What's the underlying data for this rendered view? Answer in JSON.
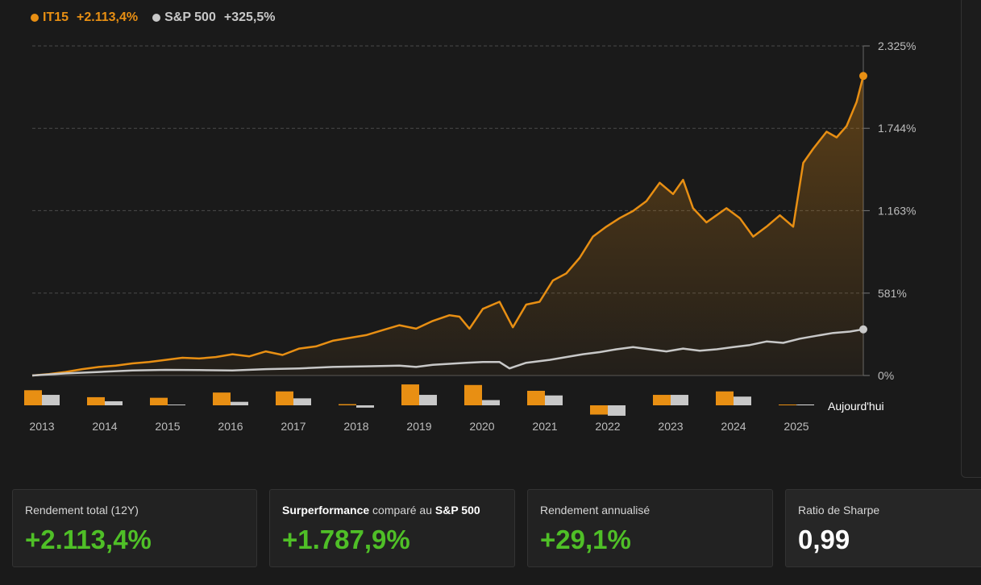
{
  "legend": {
    "series": [
      {
        "name": "IT15",
        "value": "+2.113,4%",
        "color": "#e88f13"
      },
      {
        "name": "S&P 500",
        "value": "+325,5%",
        "color": "#c8c8c8"
      }
    ]
  },
  "chart_data": {
    "type": "line",
    "x_range": [
      2013.0,
      2025.45
    ],
    "ylim": [
      0,
      2325
    ],
    "y_ticks": [
      "2.325%",
      "1.744%",
      "1.163%",
      "581%",
      "0%"
    ],
    "y_tick_values": [
      2325,
      1744,
      1163,
      581,
      0
    ],
    "grid": true,
    "series": [
      {
        "name": "IT15",
        "color": "#e88f13",
        "points": [
          [
            2013.0,
            0
          ],
          [
            2013.25,
            10
          ],
          [
            2013.5,
            25
          ],
          [
            2013.75,
            45
          ],
          [
            2014.0,
            60
          ],
          [
            2014.25,
            70
          ],
          [
            2014.5,
            85
          ],
          [
            2014.75,
            95
          ],
          [
            2015.0,
            110
          ],
          [
            2015.25,
            125
          ],
          [
            2015.5,
            120
          ],
          [
            2015.75,
            130
          ],
          [
            2016.0,
            150
          ],
          [
            2016.25,
            135
          ],
          [
            2016.5,
            170
          ],
          [
            2016.75,
            145
          ],
          [
            2017.0,
            190
          ],
          [
            2017.25,
            205
          ],
          [
            2017.5,
            245
          ],
          [
            2017.75,
            265
          ],
          [
            2018.0,
            285
          ],
          [
            2018.25,
            320
          ],
          [
            2018.5,
            355
          ],
          [
            2018.75,
            330
          ],
          [
            2019.0,
            385
          ],
          [
            2019.25,
            425
          ],
          [
            2019.4,
            415
          ],
          [
            2019.55,
            330
          ],
          [
            2019.75,
            470
          ],
          [
            2020.0,
            520
          ],
          [
            2020.2,
            340
          ],
          [
            2020.4,
            500
          ],
          [
            2020.6,
            520
          ],
          [
            2020.8,
            670
          ],
          [
            2021.0,
            720
          ],
          [
            2021.2,
            830
          ],
          [
            2021.4,
            980
          ],
          [
            2021.6,
            1050
          ],
          [
            2021.8,
            1110
          ],
          [
            2022.0,
            1160
          ],
          [
            2022.2,
            1230
          ],
          [
            2022.4,
            1360
          ],
          [
            2022.6,
            1280
          ],
          [
            2022.75,
            1380
          ],
          [
            2022.9,
            1180
          ],
          [
            2023.1,
            1080
          ],
          [
            2023.25,
            1130
          ],
          [
            2023.4,
            1180
          ],
          [
            2023.6,
            1110
          ],
          [
            2023.8,
            980
          ],
          [
            2024.0,
            1050
          ],
          [
            2024.2,
            1130
          ],
          [
            2024.4,
            1050
          ],
          [
            2024.55,
            1500
          ],
          [
            2024.7,
            1600
          ],
          [
            2024.9,
            1720
          ],
          [
            2025.05,
            1680
          ],
          [
            2025.2,
            1760
          ],
          [
            2025.35,
            1930
          ],
          [
            2025.45,
            2113.4
          ]
        ]
      },
      {
        "name": "S&P 500",
        "color": "#c8c8c8",
        "points": [
          [
            2013.0,
            0
          ],
          [
            2013.5,
            15
          ],
          [
            2014.0,
            25
          ],
          [
            2014.5,
            35
          ],
          [
            2015.0,
            40
          ],
          [
            2015.5,
            38
          ],
          [
            2016.0,
            35
          ],
          [
            2016.5,
            45
          ],
          [
            2017.0,
            50
          ],
          [
            2017.5,
            60
          ],
          [
            2018.0,
            65
          ],
          [
            2018.5,
            70
          ],
          [
            2018.75,
            60
          ],
          [
            2019.0,
            75
          ],
          [
            2019.5,
            90
          ],
          [
            2019.75,
            95
          ],
          [
            2020.0,
            95
          ],
          [
            2020.15,
            50
          ],
          [
            2020.4,
            90
          ],
          [
            2020.75,
            110
          ],
          [
            2021.0,
            130
          ],
          [
            2021.25,
            150
          ],
          [
            2021.5,
            165
          ],
          [
            2021.75,
            185
          ],
          [
            2022.0,
            200
          ],
          [
            2022.25,
            185
          ],
          [
            2022.5,
            170
          ],
          [
            2022.75,
            190
          ],
          [
            2023.0,
            175
          ],
          [
            2023.25,
            185
          ],
          [
            2023.5,
            200
          ],
          [
            2023.75,
            215
          ],
          [
            2024.0,
            240
          ],
          [
            2024.25,
            230
          ],
          [
            2024.5,
            260
          ],
          [
            2024.75,
            280
          ],
          [
            2025.0,
            300
          ],
          [
            2025.25,
            310
          ],
          [
            2025.45,
            325.5
          ]
        ]
      }
    ],
    "annual_bars": {
      "years": [
        "2013",
        "2014",
        "2015",
        "2016",
        "2017",
        "2018",
        "2019",
        "2020",
        "2021",
        "2022",
        "2023",
        "2024",
        "2025"
      ],
      "it15": [
        26,
        14,
        13,
        22,
        24,
        2,
        36,
        35,
        25,
        -16,
        18,
        24,
        1
      ],
      "sp500": [
        18,
        7,
        1,
        6,
        12,
        -4,
        18,
        9,
        17,
        -18,
        18,
        15,
        1
      ]
    },
    "today_label": "Aujourd'hui"
  },
  "cards": [
    {
      "label_parts": [
        {
          "text": "Rendement total (12Y)",
          "bold": false
        }
      ],
      "value": "+2.113,4%",
      "color": "#4fbf27"
    },
    {
      "label_parts": [
        {
          "text": "Surperformance",
          "bold": true
        },
        {
          "text": " comparé au ",
          "bold": false
        },
        {
          "text": "S&P 500",
          "bold": true
        }
      ],
      "value": "+1.787,9%",
      "color": "#4fbf27"
    },
    {
      "label_parts": [
        {
          "text": "Rendement annualisé",
          "bold": false
        }
      ],
      "value": "+29,1%",
      "color": "#4fbf27"
    },
    {
      "label_parts": [
        {
          "text": "Ratio de Sharpe",
          "bold": false
        }
      ],
      "value": "0,99",
      "color": "#ffffff"
    }
  ]
}
